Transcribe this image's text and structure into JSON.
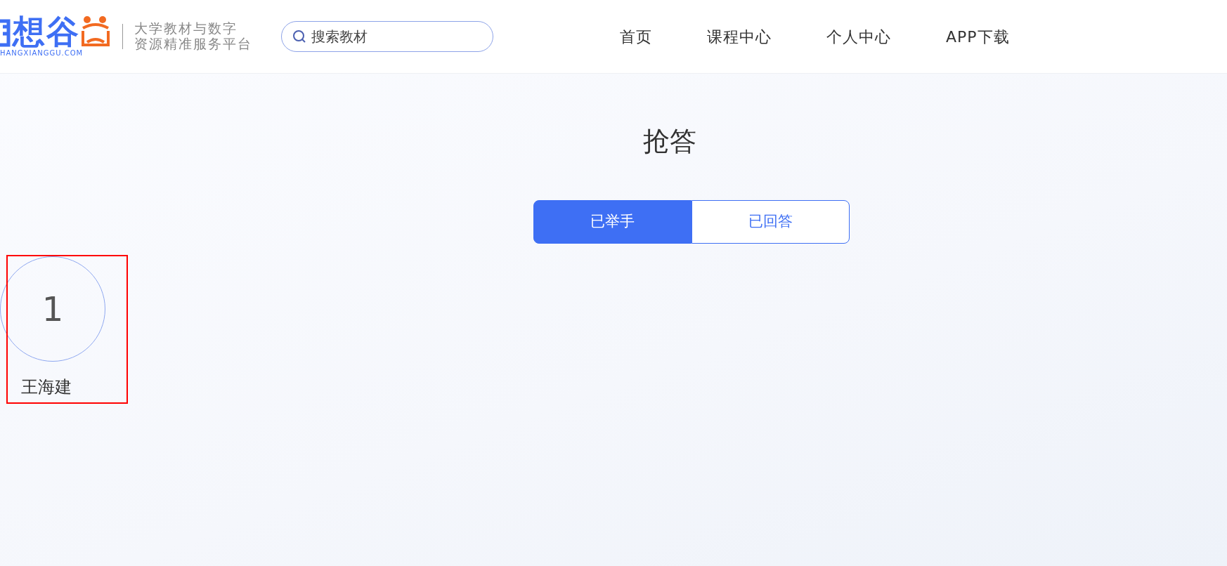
{
  "header": {
    "logo_text": "想谷",
    "logo_domain": "HANGXIANGGU.COM",
    "slogan_lines": [
      "大学教材与数字",
      "资源精准服务平台"
    ],
    "search": {
      "placeholder": "搜索教材"
    },
    "nav": [
      {
        "label": "首页"
      },
      {
        "label": "课程中心"
      },
      {
        "label": "个人中心"
      },
      {
        "label": "APP下载"
      }
    ]
  },
  "title": "抢答",
  "tabs": [
    {
      "label": "已举手",
      "selected": true
    },
    {
      "label": "已回答",
      "selected": false
    }
  ],
  "students": [
    {
      "rank": "1",
      "name": "王海建",
      "highlighted": true
    }
  ]
}
